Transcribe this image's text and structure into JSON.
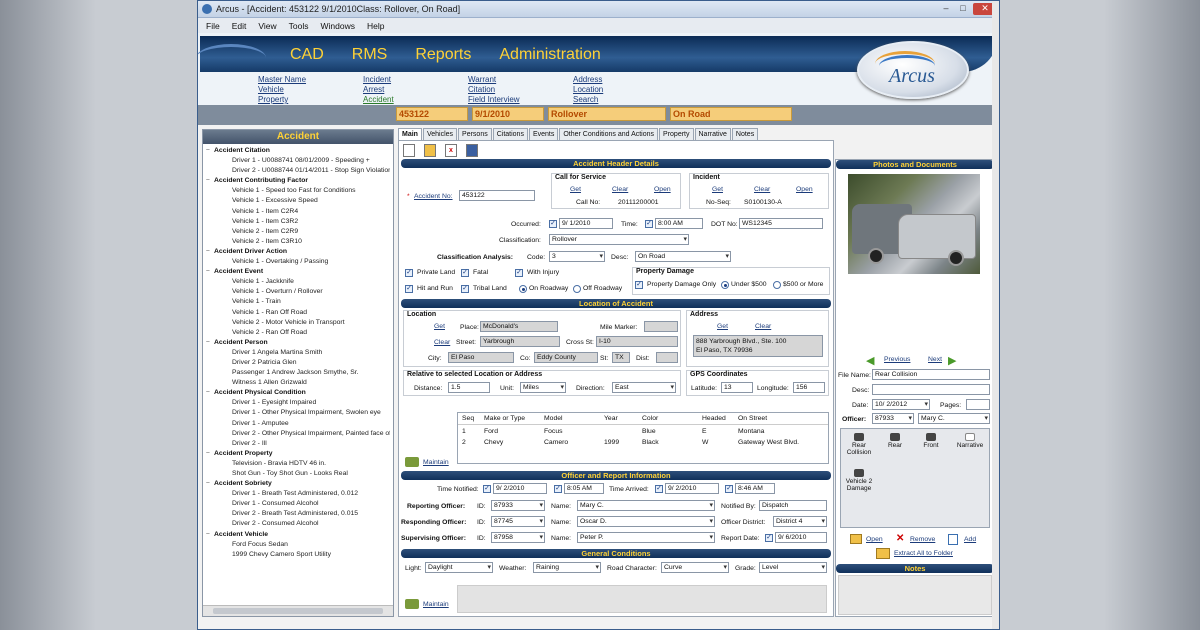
{
  "window": {
    "title": "Arcus - [Accident: 453122 9/1/2010Class: Rollover, On Road]",
    "min": "–",
    "max": "□",
    "close": "✕"
  },
  "menu": [
    "File",
    "Edit",
    "View",
    "Tools",
    "Windows",
    "Help"
  ],
  "topnav": [
    "CAD",
    "RMS",
    "Reports",
    "Administration"
  ],
  "logo": "Arcus",
  "sublinks": [
    [
      "Master Name",
      "Vehicle",
      "Property"
    ],
    [
      "Incident",
      "Arrest",
      "Accident"
    ],
    [
      "Warrant",
      "Citation",
      "Field Interview"
    ],
    [
      "Address",
      "Location",
      "Search"
    ]
  ],
  "strip": {
    "id": "453122",
    "date": "9/1/2010",
    "class": "Rollover",
    "desc": "On Road"
  },
  "left": {
    "title": "Accident",
    "tree": [
      {
        "c": "Accident Citation",
        "items": [
          "Driver 1 - U0088741 08/01/2009 - Speeding +",
          "Driver 2 - U0088744 01/14/2011 - Stop Sign Violation"
        ]
      },
      {
        "c": "Accident Contributing Factor",
        "items": [
          "Vehicle 1 - Speed too Fast for Conditions",
          "Vehicle 1 - Excessive Speed",
          "Vehicle 1 - Item C2R4",
          "Vehicle 1 - Item C3R2",
          "Vehicle 2 - Item C2R9",
          "Vehicle 2 - Item C3R10"
        ]
      },
      {
        "c": "Accident Driver Action",
        "items": [
          "Vehicle 1 - Overtaking / Passing"
        ]
      },
      {
        "c": "Accident Event",
        "items": [
          "Vehicle 1 - Jackknife",
          "Vehicle 1 - Overturn / Rollover",
          "Vehicle 1 - Train",
          "Vehicle 1 - Ran Off Road",
          "Vehicle 2 - Motor Vehicle in Transport",
          "Vehicle 2 - Ran Off Road"
        ]
      },
      {
        "c": "Accident Person",
        "items": [
          "Driver 1 Angela Martina Smith",
          "Driver 2 Patricia Glen",
          "Passenger 1 Andrew Jackson Smythe, Sr.",
          "Witness 1 Allen Grizwald"
        ]
      },
      {
        "c": "Accident Physical Condition",
        "items": [
          "Driver 1 - Eyesight Impaired",
          "Driver 1 - Other Physical Impairment, Swolen eye",
          "Driver 1 - Amputee",
          "Driver 2 - Other Physical Impairment, Painted face of s",
          "Driver 2 - Ill"
        ]
      },
      {
        "c": "Accident Property",
        "items": [
          "Television - Bravia HDTV 46 in.",
          "Shot Gun - Toy Shot Gun - Looks Real"
        ]
      },
      {
        "c": "Accident Sobriety",
        "items": [
          "Driver 1 - Breath Test Administered, 0.012",
          "Driver 1 - Consumed Alcohol",
          "Driver 2 - Breath Test Administered, 0.015",
          "Driver 2 - Consumed Alcohol"
        ]
      },
      {
        "c": "Accident Vehicle",
        "items": [
          "Ford Focus Sedan",
          "1999 Chevy Camero Sport Utility"
        ]
      }
    ]
  },
  "tabs": [
    "Main",
    "Vehicles",
    "Persons",
    "Citations",
    "Events",
    "Other Conditions and Actions",
    "Property",
    "Narrative",
    "Notes"
  ],
  "toolbar_icons": [
    "new-icon",
    "open-folder-icon",
    "delete-icon",
    "save-icon"
  ],
  "hdr": {
    "title": "Accident Header Details",
    "accident_no_label": "Accident No:",
    "accident_no": "453122",
    "cfs_title": "Call for Service",
    "get": "Get",
    "clear": "Clear",
    "open": "Open",
    "call_no_label": "Call No:",
    "call_no": "20111200001",
    "inc_title": "Incident",
    "noseq_label": "No-Seq:",
    "noseq": "S0100130-A",
    "occurred_label": "Occurred:",
    "occurred": "9/ 1/2010",
    "time_label": "Time:",
    "time": "8:00 AM",
    "dot_label": "DOT No:",
    "dot": "WS12345",
    "class_label": "Classification:",
    "class": "Rollover",
    "ca_label": "Classification Analysis:",
    "code_label": "Code:",
    "code": "3",
    "desc_label": "Desc:",
    "desc": "On Road",
    "checks": [
      "Private Land",
      "Fatal",
      "With Injury",
      "Hit and Run",
      "Tribal Land"
    ],
    "on_roadway": "On Roadway",
    "off_roadway": "Off Roadway",
    "pd_title": "Property Damage",
    "pd_only": "Property Damage Only",
    "under500": "Under $500",
    "over500": "$500 or More"
  },
  "loc": {
    "title": "Location of Accident",
    "location": "Location",
    "place_label": "Place:",
    "place": "McDonald's",
    "mm_label": "Mile Marker:",
    "street_label": "Street:",
    "street": "Yarbrough",
    "cross_label": "Cross St:",
    "cross": "I-10",
    "city_label": "City:",
    "city": "El Paso",
    "co_label": "Co:",
    "co": "Eddy County",
    "st_label": "St:",
    "st": "TX",
    "dist_label": "Dist:",
    "address": "Address",
    "addr1": "888 Yarbrough Blvd., Ste. 100",
    "addr2": "El Paso, TX  79936",
    "rel_title": "Relative to selected Location or Address",
    "distance_label": "Distance:",
    "distance": "1.5",
    "unit_label": "Unit:",
    "unit": "Miles",
    "dir_label": "Direction:",
    "dir": "East",
    "gps_title": "GPS Coordinates",
    "lat_label": "Latitude:",
    "lat": "13",
    "lon_label": "Longitude:",
    "lon": "156"
  },
  "vehicles": {
    "headers": [
      "Seq",
      "Make or Type",
      "Model",
      "Year",
      "Color",
      "Headed",
      "On Street"
    ],
    "rows": [
      [
        "1",
        "Ford",
        "Focus",
        "",
        "Blue",
        "E",
        "Montana"
      ],
      [
        "2",
        "Chevy",
        "Camero",
        "1999",
        "Black",
        "W",
        "Gateway West Blvd."
      ]
    ],
    "maintain": "Maintain"
  },
  "officer": {
    "title": "Officer and Report Information",
    "tn_label": "Time Notified:",
    "tn_date": "9/ 2/2010",
    "tn_time": "8:05 AM",
    "ta_label": "Time Arrived:",
    "ta_date": "9/ 2/2010",
    "ta_time": "8:46 AM",
    "rep_label": "Reporting Officer:",
    "id_label": "ID:",
    "name_label": "Name:",
    "rep_id": "87933",
    "rep_name": "Mary C.",
    "nb_label": "Notified By:",
    "nb": "Dispatch",
    "resp_label": "Responding Officer:",
    "resp_id": "87745",
    "resp_name": "Oscar D.",
    "od_label": "Officer District:",
    "od": "District 4",
    "sup_label": "Supervising Officer:",
    "sup_id": "87958",
    "sup_name": "Peter P.",
    "rd_label": "Report Date:",
    "rd": "9/ 6/2010"
  },
  "cond": {
    "title": "General Conditions",
    "light_label": "Light:",
    "light": "Daylight",
    "weather_label": "Weather:",
    "weather": "Raining",
    "road_label": "Road Character:",
    "road": "Curve",
    "grade_label": "Grade:",
    "grade": "Level",
    "maintain": "Maintain"
  },
  "photos": {
    "title": "Photos and Documents",
    "prev": "Previous",
    "next": "Next",
    "fn_label": "File Name:",
    "fn": "Rear Collision",
    "desc_label": "Desc:",
    "date_label": "Date:",
    "date": "10/ 2/2012",
    "pages_label": "Pages:",
    "officer_label": "Officer:",
    "officer_id": "87933",
    "officer_name": "Mary C.",
    "thumbs": [
      "Rear Collision",
      "Rear",
      "Front",
      "Narrative",
      "Vehicle 2 Damage"
    ],
    "open": "Open",
    "remove": "Remove",
    "add": "Add",
    "extract": "Extract All to Folder",
    "notes": "Notes"
  }
}
